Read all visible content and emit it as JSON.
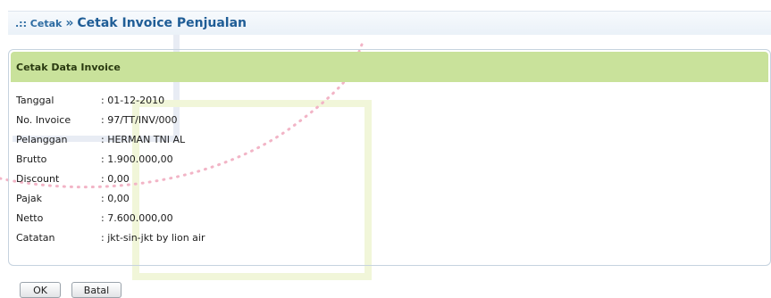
{
  "header": {
    "crumb": ".:: Cetak",
    "separator": "»",
    "title": "Cetak Invoice Penjualan"
  },
  "panel": {
    "title": "Cetak Data Invoice",
    "rows": [
      {
        "label": "Tanggal",
        "value": ": 01-12-2010"
      },
      {
        "label": "No. Invoice",
        "value": ": 97/TT/INV/000"
      },
      {
        "label": "Pelanggan",
        "value": ": HERMAN TNI AL"
      },
      {
        "label": "Brutto",
        "value": ": 1.900.000,00"
      },
      {
        "label": "Discount",
        "value": ": 0,00"
      },
      {
        "label": "Pajak",
        "value": ": 0,00"
      },
      {
        "label": "Netto",
        "value": ": 7.600.000,00"
      },
      {
        "label": "Catatan",
        "value": ": jkt-sin-jkt by lion air"
      }
    ]
  },
  "buttons": {
    "ok": "OK",
    "cancel": "Batal"
  },
  "colors": {
    "accent": "#1f5d96",
    "panel_header": "#c9e29b"
  }
}
